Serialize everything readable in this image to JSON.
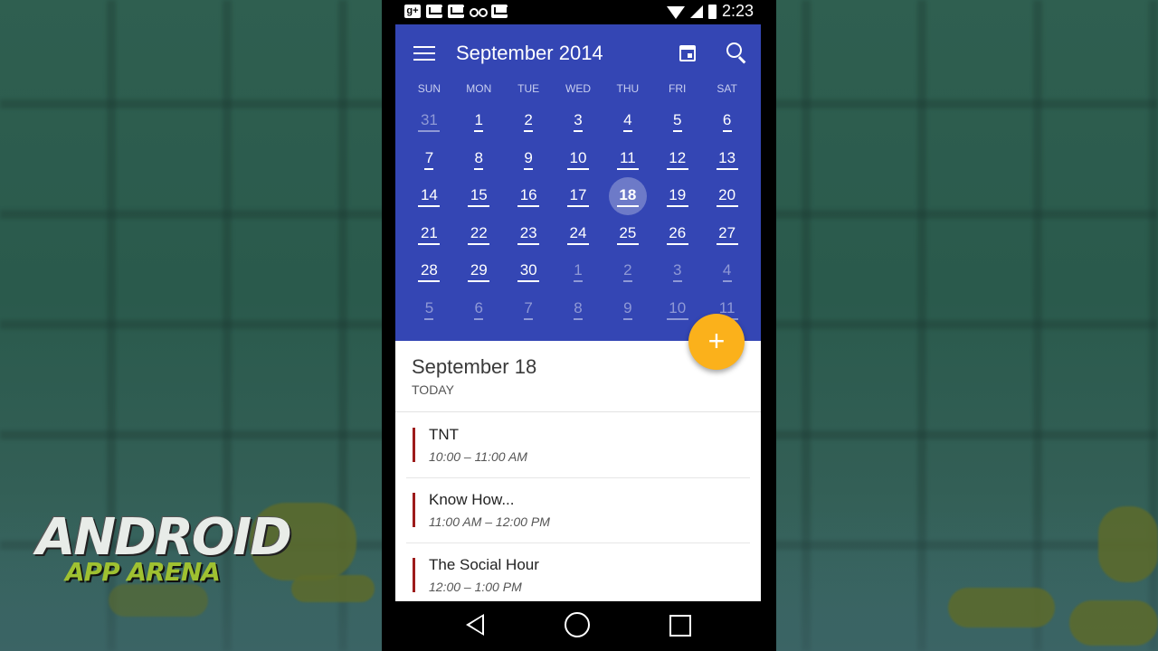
{
  "statusbar": {
    "time": "2:23",
    "icons": [
      "google-plus-icon",
      "gmail-icon",
      "gmail-icon",
      "voicemail-icon",
      "gmail-icon",
      "wifi-icon",
      "signal-icon",
      "battery-icon"
    ]
  },
  "toolbar": {
    "title": "September 2014",
    "menu_icon": "hamburger-menu-icon",
    "today_icon": "calendar-today-icon",
    "search_icon": "search-icon"
  },
  "weekdays": [
    "SUN",
    "MON",
    "TUE",
    "WED",
    "THU",
    "FRI",
    "SAT"
  ],
  "weeks": [
    [
      {
        "n": "31",
        "other": true
      },
      {
        "n": "1"
      },
      {
        "n": "2"
      },
      {
        "n": "3"
      },
      {
        "n": "4"
      },
      {
        "n": "5"
      },
      {
        "n": "6"
      }
    ],
    [
      {
        "n": "7"
      },
      {
        "n": "8"
      },
      {
        "n": "9"
      },
      {
        "n": "10"
      },
      {
        "n": "11"
      },
      {
        "n": "12"
      },
      {
        "n": "13"
      }
    ],
    [
      {
        "n": "14"
      },
      {
        "n": "15"
      },
      {
        "n": "16"
      },
      {
        "n": "17"
      },
      {
        "n": "18",
        "today": true
      },
      {
        "n": "19"
      },
      {
        "n": "20"
      }
    ],
    [
      {
        "n": "21"
      },
      {
        "n": "22"
      },
      {
        "n": "23"
      },
      {
        "n": "24"
      },
      {
        "n": "25"
      },
      {
        "n": "26"
      },
      {
        "n": "27"
      }
    ],
    [
      {
        "n": "28"
      },
      {
        "n": "29"
      },
      {
        "n": "30"
      },
      {
        "n": "1",
        "other": true
      },
      {
        "n": "2",
        "other": true
      },
      {
        "n": "3",
        "other": true
      },
      {
        "n": "4",
        "other": true
      }
    ],
    [
      {
        "n": "5",
        "other": true
      },
      {
        "n": "6",
        "other": true
      },
      {
        "n": "7",
        "other": true
      },
      {
        "n": "8",
        "other": true
      },
      {
        "n": "9",
        "other": true
      },
      {
        "n": "10",
        "other": true
      },
      {
        "n": "11",
        "other": true
      }
    ]
  ],
  "fab": {
    "label": "+"
  },
  "selected_day": {
    "date": "September 18",
    "sub": "TODAY"
  },
  "events": [
    {
      "title": "TNT",
      "time": "10:00 – 11:00 AM"
    },
    {
      "title": "Know How...",
      "time": "11:00 AM – 12:00 PM"
    },
    {
      "title": "The Social Hour",
      "time": "12:00 – 1:00 PM"
    }
  ],
  "watermark": {
    "line1": "ANDROID",
    "line2": "APP ARENA"
  },
  "colors": {
    "header": "#3446b4",
    "fab": "#fbb11b",
    "event_stripe": "#9d1b1b"
  }
}
